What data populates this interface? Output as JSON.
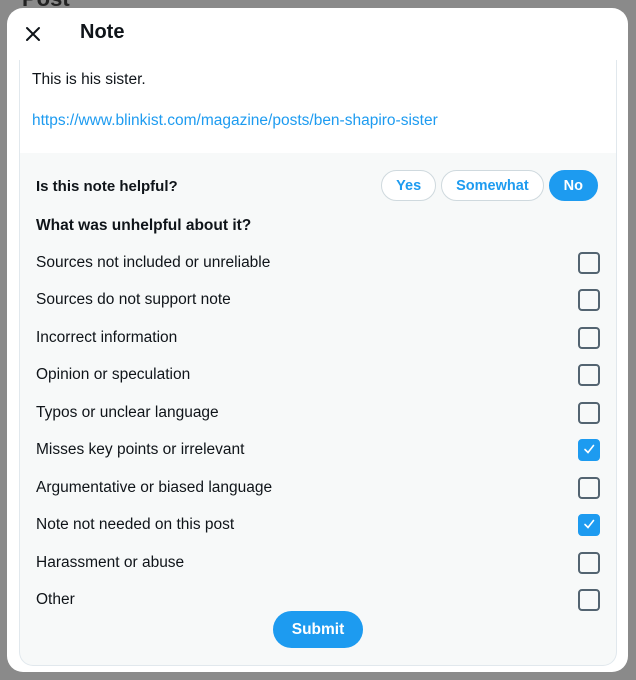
{
  "background": {
    "title": "Post"
  },
  "dialog": {
    "title": "Note",
    "close_icon": "close-icon",
    "note_text": "This is his sister.",
    "note_link": "https://www.blinkist.com/magazine/posts/ben-shapiro-sister",
    "helpful_question": "Is this note helpful?",
    "helpful_options": [
      {
        "label": "Yes",
        "selected": false
      },
      {
        "label": "Somewhat",
        "selected": false
      },
      {
        "label": "No",
        "selected": true
      }
    ],
    "unhelpful_question": "What was unhelpful about it?",
    "reasons": [
      {
        "label": "Sources not included or unreliable",
        "checked": false
      },
      {
        "label": "Sources do not support note",
        "checked": false
      },
      {
        "label": "Incorrect information",
        "checked": false
      },
      {
        "label": "Opinion or speculation",
        "checked": false
      },
      {
        "label": "Typos or unclear language",
        "checked": false
      },
      {
        "label": "Misses key points or irrelevant",
        "checked": true
      },
      {
        "label": "Argumentative or biased language",
        "checked": false
      },
      {
        "label": "Note not needed on this post",
        "checked": true
      },
      {
        "label": "Harassment or abuse",
        "checked": false
      },
      {
        "label": "Other",
        "checked": false
      }
    ],
    "submit_label": "Submit",
    "accent_color": "#1d9bf0"
  }
}
